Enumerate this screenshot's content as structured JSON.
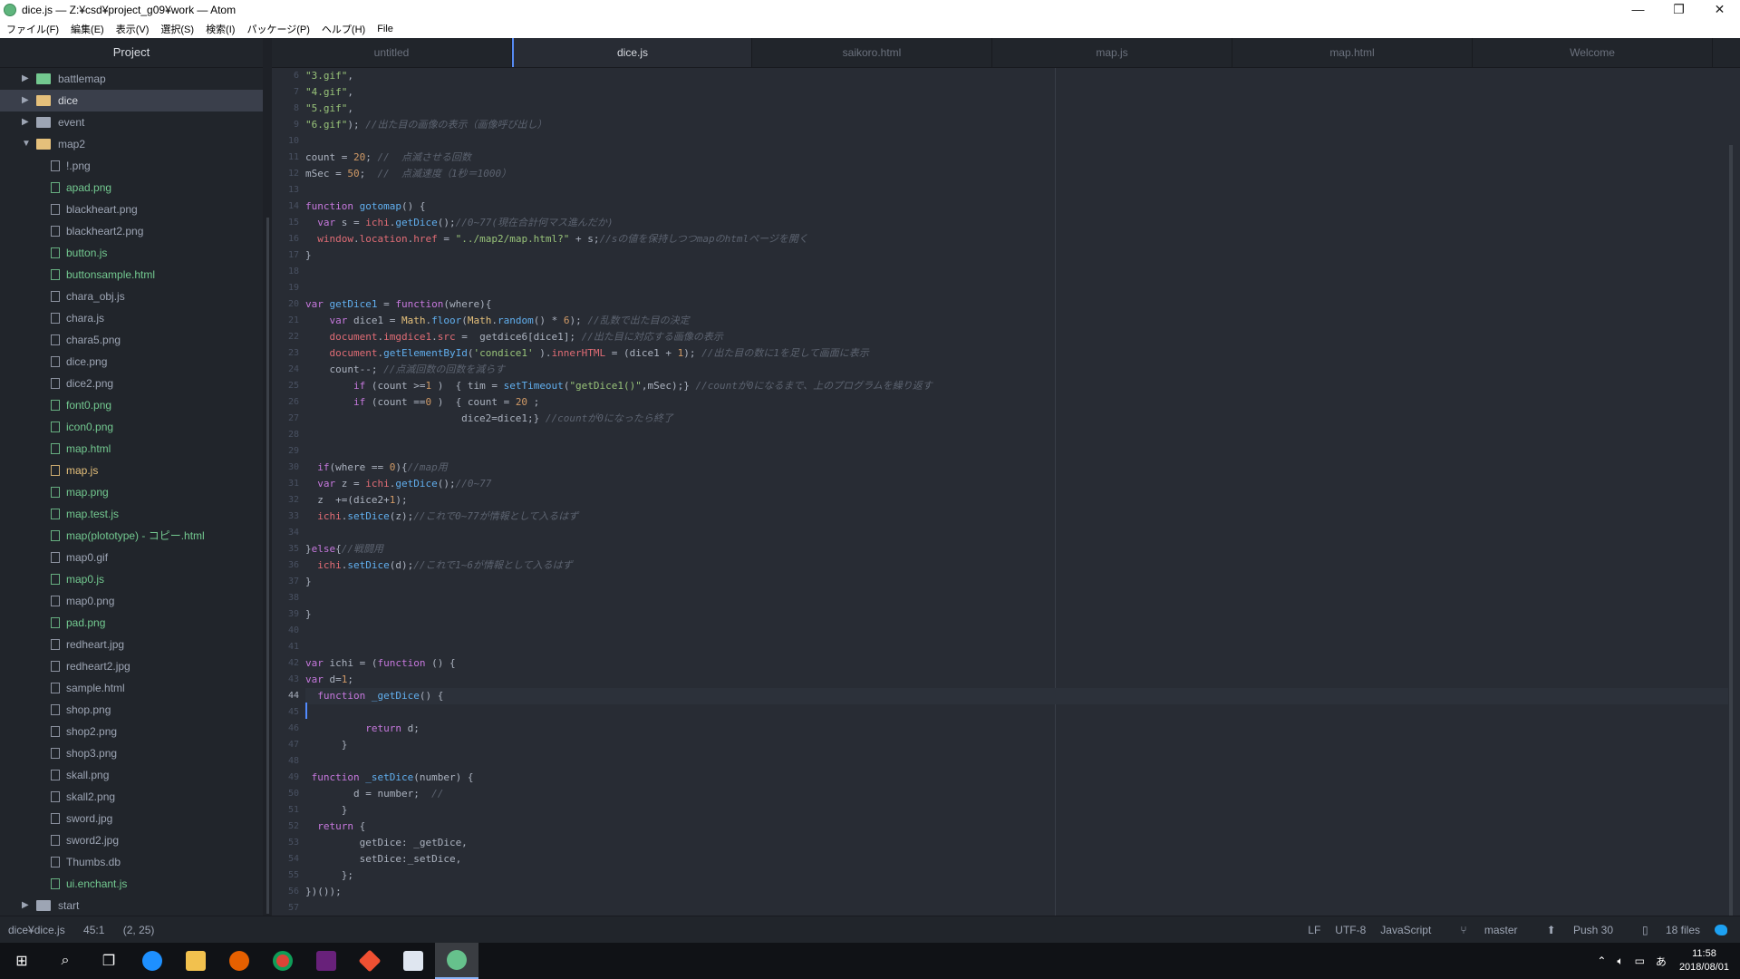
{
  "window": {
    "title": "dice.js — Z:¥csd¥project_g09¥work — Atom",
    "controls": [
      "—",
      "❐",
      "✕"
    ]
  },
  "menu": [
    "ファイル(F)",
    "編集(E)",
    "表示(V)",
    "選択(S)",
    "検索(I)",
    "パッケージ(P)",
    "ヘルプ(H)",
    "File"
  ],
  "tree": {
    "header": "Project",
    "items": [
      {
        "kind": "dir",
        "label": "battlemap",
        "open": false,
        "color": "green"
      },
      {
        "kind": "dir",
        "label": "dice",
        "open": false,
        "color": "orange",
        "selected": true
      },
      {
        "kind": "dir",
        "label": "event",
        "open": false,
        "color": "default"
      },
      {
        "kind": "dir",
        "label": "map2",
        "open": true,
        "color": "orange"
      },
      {
        "kind": "file",
        "label": "!.png",
        "color": "default"
      },
      {
        "kind": "file",
        "label": "apad.png",
        "color": "green"
      },
      {
        "kind": "file",
        "label": "blackheart.png",
        "color": "default"
      },
      {
        "kind": "file",
        "label": "blackheart2.png",
        "color": "default"
      },
      {
        "kind": "file",
        "label": "button.js",
        "color": "green"
      },
      {
        "kind": "file",
        "label": "buttonsample.html",
        "color": "green"
      },
      {
        "kind": "file",
        "label": "chara_obj.js",
        "color": "default"
      },
      {
        "kind": "file",
        "label": "chara.js",
        "color": "default"
      },
      {
        "kind": "file",
        "label": "chara5.png",
        "color": "default"
      },
      {
        "kind": "file",
        "label": "dice.png",
        "color": "default"
      },
      {
        "kind": "file",
        "label": "dice2.png",
        "color": "default"
      },
      {
        "kind": "file",
        "label": "font0.png",
        "color": "green"
      },
      {
        "kind": "file",
        "label": "icon0.png",
        "color": "green"
      },
      {
        "kind": "file",
        "label": "map.html",
        "color": "green"
      },
      {
        "kind": "file",
        "label": "map.js",
        "color": "orange"
      },
      {
        "kind": "file",
        "label": "map.png",
        "color": "green"
      },
      {
        "kind": "file",
        "label": "map.test.js",
        "color": "green"
      },
      {
        "kind": "file",
        "label": "map(plototype) - コピー.html",
        "color": "green"
      },
      {
        "kind": "file",
        "label": "map0.gif",
        "color": "default"
      },
      {
        "kind": "file",
        "label": "map0.js",
        "color": "green"
      },
      {
        "kind": "file",
        "label": "map0.png",
        "color": "default"
      },
      {
        "kind": "file",
        "label": "pad.png",
        "color": "green"
      },
      {
        "kind": "file",
        "label": "redheart.jpg",
        "color": "default"
      },
      {
        "kind": "file",
        "label": "redheart2.jpg",
        "color": "default"
      },
      {
        "kind": "file",
        "label": "sample.html",
        "color": "default"
      },
      {
        "kind": "file",
        "label": "shop.png",
        "color": "default"
      },
      {
        "kind": "file",
        "label": "shop2.png",
        "color": "default"
      },
      {
        "kind": "file",
        "label": "shop3.png",
        "color": "default"
      },
      {
        "kind": "file",
        "label": "skall.png",
        "color": "default"
      },
      {
        "kind": "file",
        "label": "skall2.png",
        "color": "default"
      },
      {
        "kind": "file",
        "label": "sword.jpg",
        "color": "default"
      },
      {
        "kind": "file",
        "label": "sword2.jpg",
        "color": "default"
      },
      {
        "kind": "file",
        "label": "Thumbs.db",
        "color": "default"
      },
      {
        "kind": "file",
        "label": "ui.enchant.js",
        "color": "green"
      },
      {
        "kind": "dir",
        "label": "start",
        "open": false,
        "color": "default"
      }
    ]
  },
  "tabs": [
    {
      "label": "untitled",
      "active": false
    },
    {
      "label": "dice.js",
      "active": true
    },
    {
      "label": "saikoro.html",
      "active": false
    },
    {
      "label": "map.js",
      "active": false
    },
    {
      "label": "map.html",
      "active": false
    },
    {
      "label": "Welcome",
      "active": false
    }
  ],
  "editor": {
    "current_line": 44,
    "lines": [
      {
        "n": "6",
        "t": [
          [
            "st",
            "\"3.gif\""
          ],
          [
            "",
            ","
          ]
        ]
      },
      {
        "n": "7",
        "t": [
          [
            "st",
            "\"4.gif\""
          ],
          [
            "",
            ","
          ]
        ]
      },
      {
        "n": "8",
        "t": [
          [
            "st",
            "\"5.gif\""
          ],
          [
            "",
            ","
          ]
        ]
      },
      {
        "n": "9",
        "t": [
          [
            "st",
            "\"6.gif\""
          ],
          [
            "",
            "); "
          ],
          [
            "cm",
            "//出た目の画像の表示（画像呼び出し）"
          ]
        ]
      },
      {
        "n": "10",
        "t": []
      },
      {
        "n": "11",
        "t": [
          [
            "",
            "count = "
          ],
          [
            "nu",
            "20"
          ],
          [
            "",
            "; "
          ],
          [
            "cm",
            "//  点滅させる回数"
          ]
        ]
      },
      {
        "n": "12",
        "t": [
          [
            "",
            "mSec = "
          ],
          [
            "nu",
            "50"
          ],
          [
            "",
            "; "
          ],
          [
            "cm",
            " //  点滅速度（1秒＝1000）"
          ]
        ]
      },
      {
        "n": "13",
        "t": []
      },
      {
        "n": "14",
        "t": [
          [
            "kw",
            "function "
          ],
          [
            "fn",
            "gotomap"
          ],
          [
            "",
            "() {"
          ]
        ]
      },
      {
        "n": "15",
        "t": [
          [
            "kw",
            "  var "
          ],
          [
            "",
            "s = "
          ],
          [
            "va",
            "ichi"
          ],
          [
            "",
            "."
          ],
          [
            "fn",
            "getDice"
          ],
          [
            "",
            "();"
          ],
          [
            "cm",
            "//0~77(現在合計何マス進んだか)"
          ]
        ]
      },
      {
        "n": "16",
        "t": [
          [
            "va",
            "  window"
          ],
          [
            "",
            "."
          ],
          [
            "va",
            "location"
          ],
          [
            "",
            "."
          ],
          [
            "va",
            "href"
          ],
          [
            "",
            " = "
          ],
          [
            "st",
            "\"../map2/map.html?\""
          ],
          [
            "",
            " + s;"
          ],
          [
            "cm",
            "//sの値を保持しつつmapのhtmlページを開く"
          ]
        ]
      },
      {
        "n": "17",
        "t": [
          [
            "",
            "}"
          ]
        ]
      },
      {
        "n": "18",
        "t": []
      },
      {
        "n": "19",
        "t": []
      },
      {
        "n": "20",
        "t": [
          [
            "kw",
            "var "
          ],
          [
            "fn",
            "getDice1"
          ],
          [
            "",
            " = "
          ],
          [
            "kw",
            "function"
          ],
          [
            "",
            "(where){"
          ]
        ]
      },
      {
        "n": "21",
        "t": [
          [
            "kw",
            "    var "
          ],
          [
            "",
            "dice1 = "
          ],
          [
            "ob",
            "Math"
          ],
          [
            "",
            "."
          ],
          [
            "fn",
            "floor"
          ],
          [
            "",
            "("
          ],
          [
            "ob",
            "Math"
          ],
          [
            "",
            "."
          ],
          [
            "fn",
            "random"
          ],
          [
            "",
            "() * "
          ],
          [
            "nu",
            "6"
          ],
          [
            "",
            "); "
          ],
          [
            "cm",
            "//乱数で出た目の決定"
          ]
        ]
      },
      {
        "n": "22",
        "t": [
          [
            "va",
            "    document"
          ],
          [
            "",
            "."
          ],
          [
            "va",
            "imgdice1"
          ],
          [
            "",
            "."
          ],
          [
            "va",
            "src"
          ],
          [
            "",
            " =  getdice6[dice1]; "
          ],
          [
            "cm",
            "//出た目に対応する画像の表示"
          ]
        ]
      },
      {
        "n": "23",
        "t": [
          [
            "va",
            "    document"
          ],
          [
            "",
            "."
          ],
          [
            "fn",
            "getElementById"
          ],
          [
            "",
            "("
          ],
          [
            "st",
            "'condice1'"
          ],
          [
            "",
            " )."
          ],
          [
            "va",
            "innerHTML"
          ],
          [
            "",
            " = (dice1 + "
          ],
          [
            "nu",
            "1"
          ],
          [
            "",
            "); "
          ],
          [
            "cm",
            "//出た目の数に1を足して画面に表示"
          ]
        ]
      },
      {
        "n": "24",
        "t": [
          [
            "",
            "    count--; "
          ],
          [
            "cm",
            "//点滅回数の回数を減らす"
          ]
        ]
      },
      {
        "n": "25",
        "t": [
          [
            "kw",
            "        if "
          ],
          [
            "",
            "(count >="
          ],
          [
            "nu",
            "1"
          ],
          [
            "",
            " )  { tim = "
          ],
          [
            "fn",
            "setTimeout"
          ],
          [
            "",
            "("
          ],
          [
            "st",
            "\"getDice1()\""
          ],
          [
            "",
            ",mSec);} "
          ],
          [
            "cm",
            "//countが0になるまで、上のプログラムを繰り返す"
          ]
        ]
      },
      {
        "n": "26",
        "t": [
          [
            "kw",
            "        if "
          ],
          [
            "",
            "(count =="
          ],
          [
            "nu",
            "0"
          ],
          [
            "",
            " )  { count = "
          ],
          [
            "nu",
            "20"
          ],
          [
            "",
            " ;"
          ]
        ]
      },
      {
        "n": "27",
        "t": [
          [
            "",
            "                          dice2=dice1;} "
          ],
          [
            "cm",
            "//countが0になったら終了"
          ]
        ]
      },
      {
        "n": "28",
        "t": []
      },
      {
        "n": "29",
        "t": []
      },
      {
        "n": "30",
        "t": [
          [
            "kw",
            "  if"
          ],
          [
            "",
            "(where == "
          ],
          [
            "nu",
            "0"
          ],
          [
            "",
            ")"
          ],
          [
            "",
            "{"
          ],
          [
            "cm",
            "//map用"
          ]
        ]
      },
      {
        "n": "31",
        "t": [
          [
            "kw",
            "  var "
          ],
          [
            "",
            "z = "
          ],
          [
            "va",
            "ichi"
          ],
          [
            "",
            "."
          ],
          [
            "fn",
            "getDice"
          ],
          [
            "",
            "();"
          ],
          [
            "cm",
            "//0~77"
          ]
        ]
      },
      {
        "n": "32",
        "t": [
          [
            "",
            "  z  +=(dice2+"
          ],
          [
            "nu",
            "1"
          ],
          [
            "",
            ");"
          ]
        ]
      },
      {
        "n": "33",
        "t": [
          [
            "va",
            "  ichi"
          ],
          [
            "",
            "."
          ],
          [
            "fn",
            "setDice"
          ],
          [
            "",
            "(z);"
          ],
          [
            "cm",
            "//これで0~77が情報として入るはず"
          ]
        ]
      },
      {
        "n": "34",
        "t": []
      },
      {
        "n": "35",
        "t": [
          [
            "",
            "}"
          ],
          [
            "kw",
            "else"
          ],
          [
            "",
            "{"
          ],
          [
            "cm",
            "//戦闘用"
          ]
        ]
      },
      {
        "n": "36",
        "t": [
          [
            "va",
            "  ichi"
          ],
          [
            "",
            "."
          ],
          [
            "fn",
            "setDice"
          ],
          [
            "",
            "(d);"
          ],
          [
            "cm",
            "//これで1~6が情報として入るはず"
          ]
        ]
      },
      {
        "n": "37",
        "t": [
          [
            "",
            "}"
          ]
        ]
      },
      {
        "n": "38",
        "t": []
      },
      {
        "n": "39",
        "t": [
          [
            "",
            "}"
          ]
        ]
      },
      {
        "n": "40",
        "t": []
      },
      {
        "n": "41",
        "t": []
      },
      {
        "n": "42",
        "t": [
          [
            "kw",
            "var "
          ],
          [
            "",
            "ichi = ("
          ],
          [
            "kw",
            "function"
          ],
          [
            "",
            " () {"
          ]
        ]
      },
      {
        "n": "43",
        "t": [
          [
            "kw",
            "var "
          ],
          [
            "",
            "d="
          ],
          [
            "nu",
            "1"
          ],
          [
            "",
            ";"
          ]
        ]
      },
      {
        "n": "44",
        "t": [
          [
            "kw",
            "  function "
          ],
          [
            "fn",
            "_getDice"
          ],
          [
            "",
            "() {"
          ]
        ]
      },
      {
        "n": "45",
        "t": []
      },
      {
        "n": "46",
        "t": [
          [
            "kw",
            "          return "
          ],
          [
            "",
            "d;"
          ]
        ]
      },
      {
        "n": "47",
        "t": [
          [
            "",
            "      }"
          ]
        ]
      },
      {
        "n": "48",
        "t": []
      },
      {
        "n": "49",
        "t": [
          [
            "kw",
            " function "
          ],
          [
            "fn",
            "_setDice"
          ],
          [
            "",
            "(number) {"
          ]
        ]
      },
      {
        "n": "50",
        "t": [
          [
            "",
            "        d = number;  "
          ],
          [
            "cm",
            "//"
          ]
        ]
      },
      {
        "n": "51",
        "t": [
          [
            "",
            "      }"
          ]
        ]
      },
      {
        "n": "52",
        "t": [
          [
            "kw",
            "  return "
          ],
          [
            "",
            "{"
          ]
        ]
      },
      {
        "n": "53",
        "t": [
          [
            "",
            "         getDice: _getDice,"
          ]
        ]
      },
      {
        "n": "54",
        "t": [
          [
            "",
            "         setDice:_setDice,"
          ]
        ]
      },
      {
        "n": "55",
        "t": [
          [
            "",
            "      };"
          ]
        ]
      },
      {
        "n": "56",
        "t": [
          [
            "",
            ""
          ],
          [
            "",
            "})());"
          ]
        ]
      },
      {
        "n": "57",
        "t": []
      }
    ]
  },
  "status": {
    "file": "dice¥dice.js",
    "position": "45:1",
    "selection": "(2, 25)",
    "line_ending": "LF",
    "encoding": "UTF-8",
    "grammar": "JavaScript",
    "branch": "master",
    "push": "Push 30",
    "files": "18 files"
  },
  "taskbar": {
    "clock_time": "11:58",
    "clock_date": "2018/08/01",
    "ime": "あ"
  }
}
